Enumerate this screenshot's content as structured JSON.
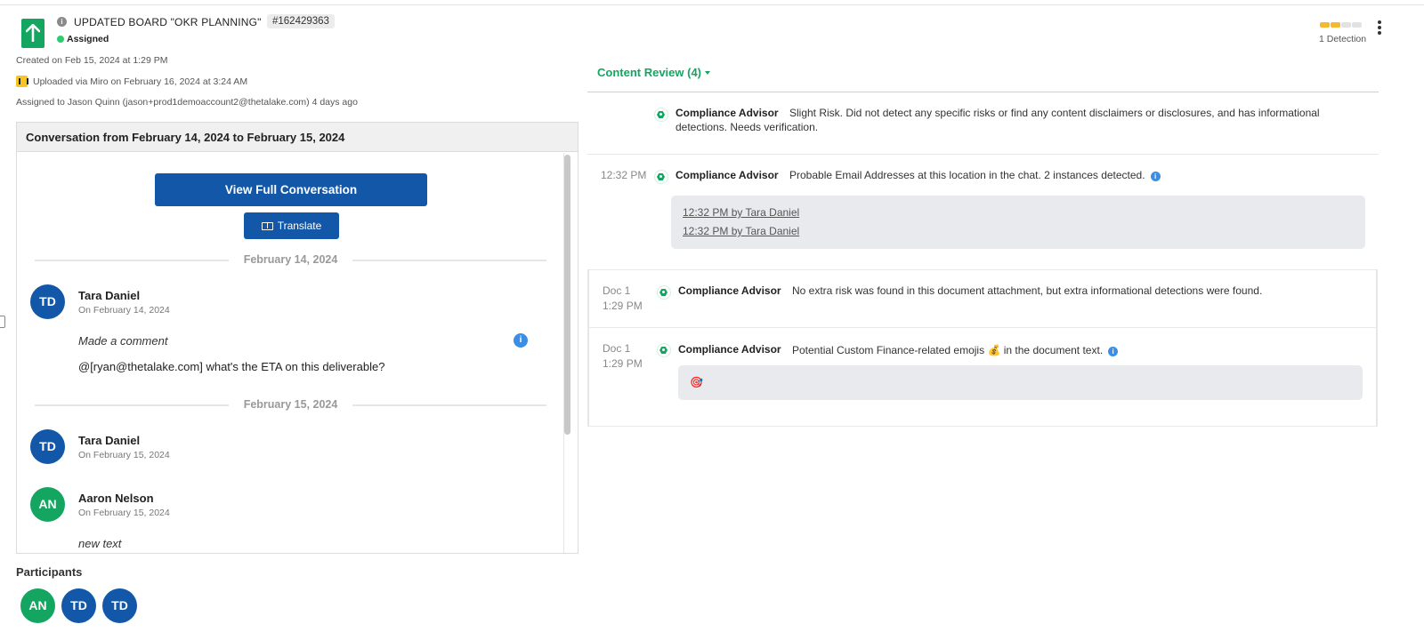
{
  "header": {
    "title": "UPDATED BOARD \"OKR PLANNING\"",
    "id_chip": "#162429363",
    "status": "Assigned",
    "created": "Created on Feb 15, 2024 at 1:29 PM",
    "uploaded": "Uploaded via Miro on February 16, 2024 at 3:24 AM",
    "assigned": "Assigned to Jason Quinn (jason+prod1demoaccount2@thetalake.com) 4 days ago",
    "detection_label": "1 Detection",
    "detection_level": 2,
    "detection_max": 4
  },
  "conversation": {
    "heading": "Conversation from February 14, 2024 to February 15, 2024",
    "view_button": "View Full Conversation",
    "translate_button": "Translate",
    "dividers": [
      "February 14, 2024",
      "February 15, 2024"
    ],
    "messages": [
      {
        "initials": "TD",
        "name": "Tara Daniel",
        "date": "On February 14, 2024",
        "action": "Made a comment",
        "text": "@[ryan@thetalake.com] what's the ETA on this deliverable?"
      },
      {
        "initials": "TD",
        "name": "Tara Daniel",
        "date": "On February 15, 2024"
      },
      {
        "initials": "AN",
        "name": "Aaron Nelson",
        "date": "On February 15, 2024",
        "action": "new text"
      }
    ]
  },
  "participants": {
    "label": "Participants",
    "items": [
      "AN",
      "TD",
      "TD"
    ]
  },
  "content_review": {
    "label": "Content Review (4)",
    "advisor": "Compliance Advisor",
    "items": [
      {
        "time": "",
        "text": "Slight Risk. Did not detect any specific risks or find any content disclaimers or disclosures, and has informational detections. Needs verification."
      },
      {
        "time": "12:32 PM",
        "text": "Probable Email Addresses at this location in the chat. 2 instances detected.",
        "links": [
          "12:32 PM  by Tara Daniel",
          "12:32 PM  by Tara Daniel"
        ]
      },
      {
        "time_a": "Doc 1",
        "time_b": "1:29 PM",
        "text": "No extra risk was found in this document attachment, but extra informational detections were found."
      },
      {
        "time_a": "Doc 1",
        "time_b": "1:29 PM",
        "text_a": "Potential Custom Finance-related emojis",
        "emoji": "💰",
        "text_b": "in the document text.",
        "box_emoji": "🎯"
      }
    ]
  },
  "colors": {
    "brand_green": "#14a561",
    "button_blue": "#1257a8",
    "info_blue": "#3a8ee6",
    "detection_yellow": "#f5b82e"
  }
}
